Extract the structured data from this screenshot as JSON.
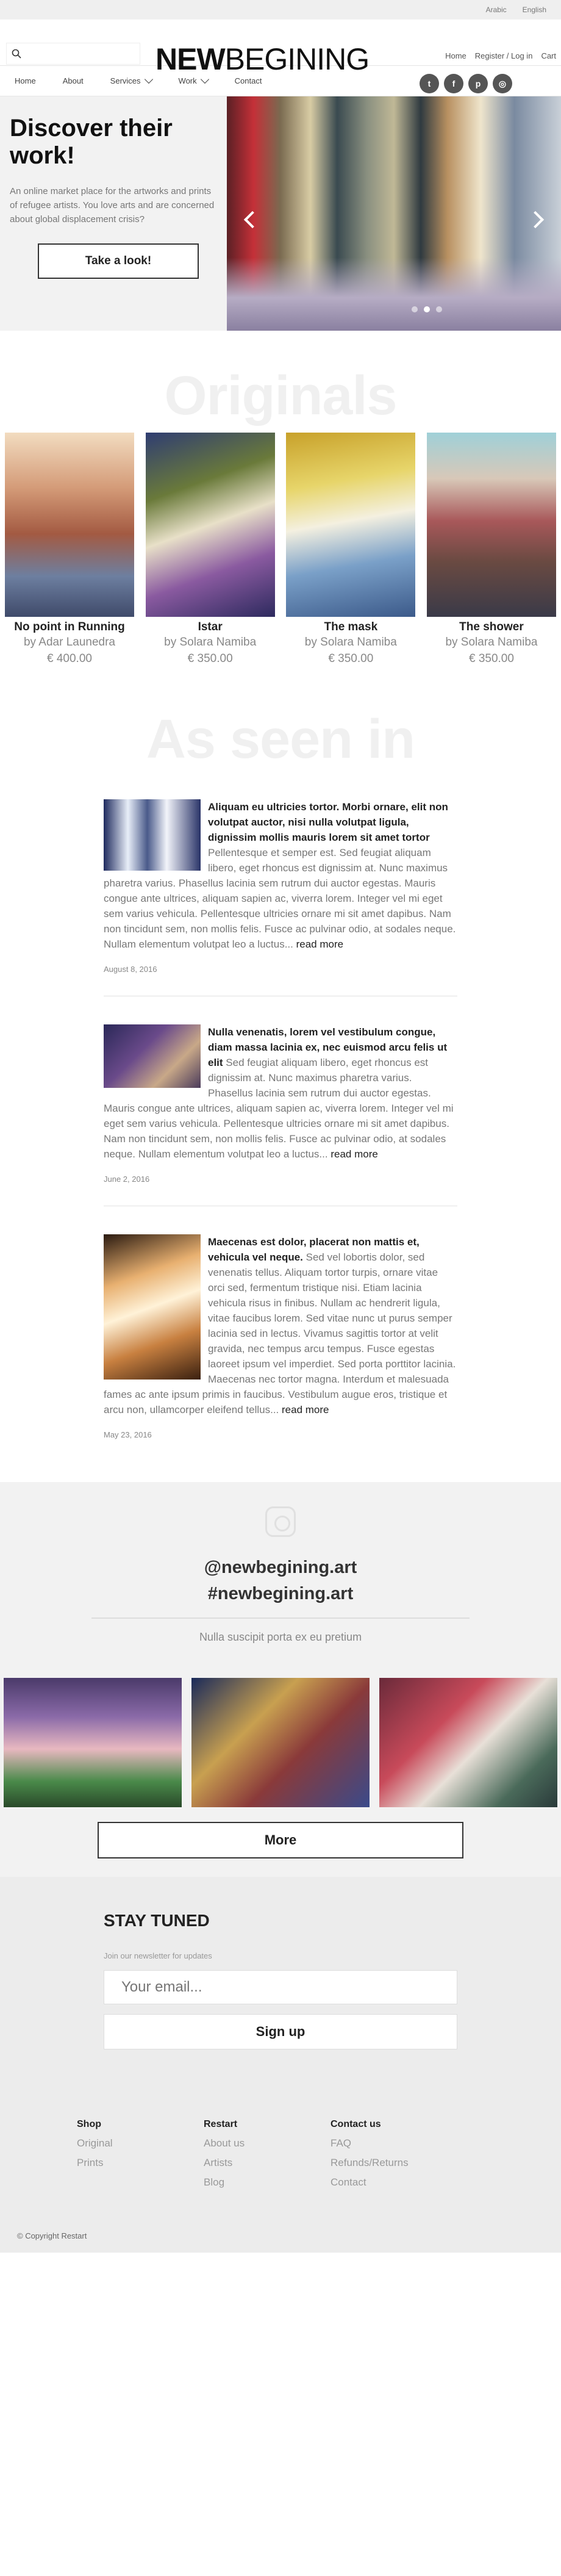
{
  "topbar": {
    "languages": [
      "Arabic",
      "English"
    ]
  },
  "header": {
    "search_placeholder": "",
    "logo_bold": "NEW",
    "logo_light": "BEGINING",
    "links": [
      "Home",
      "Register / Log in",
      "Cart"
    ]
  },
  "nav": {
    "items": [
      "Home",
      "About",
      "Services",
      "Work",
      "Contact"
    ]
  },
  "hero": {
    "title": "Discover their work!",
    "text": "An online market place for the artworks and prints of refugee artists. You love arts and are concerned about global displacement crisis?",
    "button": "Take a look!",
    "slides": 3,
    "active_slide": 1
  },
  "originals": {
    "title": "Originals",
    "items": [
      {
        "title": "No point in Running",
        "artist": "by Adar Launedra",
        "price": "€ 400.00"
      },
      {
        "title": "Istar",
        "artist": "by Solara Namiba",
        "price": "€ 350.00"
      },
      {
        "title": "The mask",
        "artist": "by Solara Namiba",
        "price": "€ 350.00"
      },
      {
        "title": "The shower",
        "artist": "by Solara Namiba",
        "price": "€ 350.00"
      }
    ]
  },
  "press": {
    "title": "As seen in",
    "more_label": "read more",
    "posts": [
      {
        "title": "Aliquam eu ultricies tortor. Morbi ornare, elit non volutpat auctor, nisi nulla volutpat ligula, dignissim mollis mauris lorem sit amet tortor",
        "text": "Pellentesque et semper est. Sed feugiat aliquam libero, eget rhoncus est dignissim at. Nunc maximus pharetra varius. Phasellus lacinia sem rutrum dui auctor egestas. Mauris congue ante ultrices, aliquam sapien ac, viverra lorem. Integer vel mi eget sem varius vehicula. Pellentesque ultricies ornare mi sit amet dapibus. Nam non tincidunt sem, non mollis felis. Fusce ac pulvinar odio, at sodales neque. Nullam elementum volutpat leo a luctus...",
        "date": "August 8, 2016"
      },
      {
        "title": "Nulla venenatis, lorem vel vestibulum congue, diam massa lacinia ex, nec euismod arcu felis ut elit",
        "text": "Sed feugiat aliquam libero, eget rhoncus est dignissim at. Nunc maximus pharetra varius. Phasellus lacinia sem rutrum dui auctor egestas. Mauris congue ante ultrices, aliquam sapien ac, viverra lorem. Integer vel mi eget sem varius vehicula. Pellentesque ultricies ornare mi sit amet dapibus. Nam non tincidunt sem, non mollis felis. Fusce ac pulvinar odio, at sodales neque. Nullam elementum volutpat leo a luctus...",
        "date": "June 2, 2016"
      },
      {
        "title": "Maecenas est dolor, placerat non mattis et, vehicula vel neque.",
        "text": "Sed vel lobortis dolor, sed venenatis tellus. Aliquam tortor turpis, ornare vitae orci sed, fermentum tristique nisi. Etiam lacinia vehicula risus in finibus. Nullam ac hendrerit ligula, vitae faucibus lorem. Sed vitae nunc ut purus semper lacinia sed in lectus. Vivamus sagittis tortor at velit gravida, nec tempus arcu tempus. Fusce egestas laoreet ipsum vel imperdiet. Sed porta porttitor lacinia. Maecenas nec tortor magna. Interdum et malesuada fames ac ante ipsum primis in faucibus. Vestibulum augue eros, tristique et arcu non, ullamcorper eleifend tellus...",
        "date": "May 23, 2016"
      }
    ]
  },
  "instagram": {
    "handle": "@newbegining.art",
    "hashtag": "#newbegining.art",
    "subtitle": "Nulla suscipit porta ex eu pretium",
    "more_button": "More"
  },
  "footer": {
    "title": "STAY TUNED",
    "subtitle": "Join our newsletter for updates",
    "email_placeholder": "Your email...",
    "signup": "Sign up",
    "columns": [
      {
        "heading": "Shop",
        "links": [
          "Original",
          "Prints"
        ]
      },
      {
        "heading": "Restart",
        "links": [
          "About us",
          "Artists",
          "Blog"
        ]
      },
      {
        "heading": "Contact us",
        "links": [
          "FAQ",
          "Refunds/Returns",
          "Contact"
        ]
      }
    ],
    "copyright": "© Copyright Restart"
  },
  "colors": {
    "accent": "#222222",
    "muted_text": "#888888",
    "panel_bg": "#f2f2f2",
    "ghost_title": "#f0f0f0"
  },
  "icons": [
    "search-icon",
    "chevron-down-icon",
    "twitter-icon",
    "facebook-icon",
    "pinterest-icon",
    "instagram-icon",
    "arrow-left-icon",
    "arrow-right-icon"
  ]
}
